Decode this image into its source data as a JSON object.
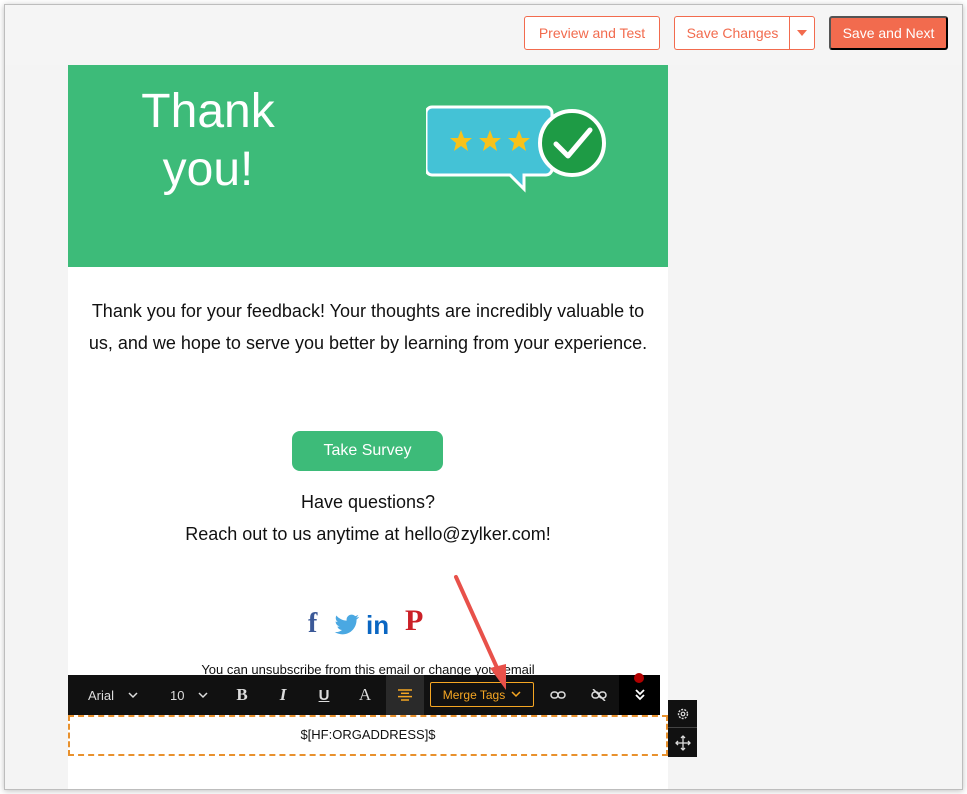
{
  "header": {
    "preview_label": "Preview and Test",
    "save_label": "Save Changes",
    "save_next_label": "Save and Next"
  },
  "email": {
    "hero_title": "Thank\nyou!",
    "body": "Thank you for your feedback! Your thoughts are incredibly valuable to us, and we hope to serve you better by learning from your experience.",
    "cta_label": "Take Survey",
    "questions_line1": "Have questions?",
    "questions_line2": "Reach out to us anytime at hello@zylker.com!",
    "unsubscribe": "You can unsubscribe from this email or change your email",
    "address_tag": "$[HF:ORGADDRESS]$"
  },
  "toolbar": {
    "font": "Arial",
    "size": "10",
    "bold": "B",
    "italic": "I",
    "underline": "U",
    "text_color": "A",
    "merge_tags": "Merge Tags"
  },
  "colors": {
    "accent": "#f26b4e",
    "hero_green": "#3dbb79",
    "merge_orange": "#f5a623"
  },
  "icons": [
    "chevron-down-icon",
    "align-center-icon",
    "link-icon",
    "unlink-icon",
    "double-chevron-icon",
    "gear-icon",
    "move-icon",
    "facebook-icon",
    "twitter-icon",
    "linkedin-icon",
    "pinterest-icon"
  ]
}
